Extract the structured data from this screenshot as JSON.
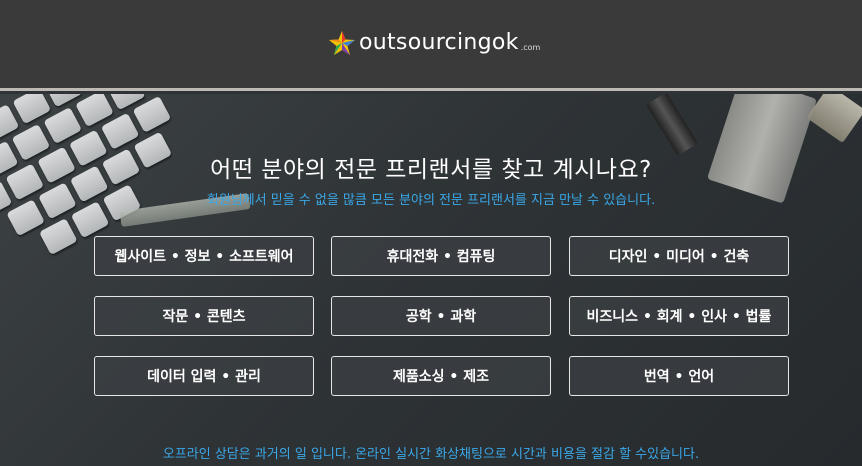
{
  "header": {
    "logo_text": "outsourcingok",
    "logo_tld": ".com",
    "logo_icon": "star-icon",
    "background": "#3a3a3b"
  },
  "hero": {
    "headline": "어떤 분야의 전문 프리랜서를 찾고 계시나요?",
    "subline": "회원님께서 믿을 수 없을 많큼 모든 분야의 전문 프리랜서를 지금 만날 수 있습니다.",
    "accent_color": "#3aa8e8"
  },
  "categories": [
    {
      "label": "웹사이트 • 정보 • 소프트웨어"
    },
    {
      "label": "휴대전화 • 컴퓨팅"
    },
    {
      "label": "디자인 • 미디어 • 건축"
    },
    {
      "label": "작문 • 콘텐츠"
    },
    {
      "label": "공학 • 과학"
    },
    {
      "label": "비즈니스 • 회계 • 인사 • 법률"
    },
    {
      "label": "데이터 입력 • 관리"
    },
    {
      "label": "제품소싱 • 제조"
    },
    {
      "label": "번역 • 언어"
    }
  ],
  "footer_note": "오프라인 상담은 과거의 일 입니다. 온라인 실시간 화상채팅으로 시간과 비용을 절감 할 수있습니다."
}
